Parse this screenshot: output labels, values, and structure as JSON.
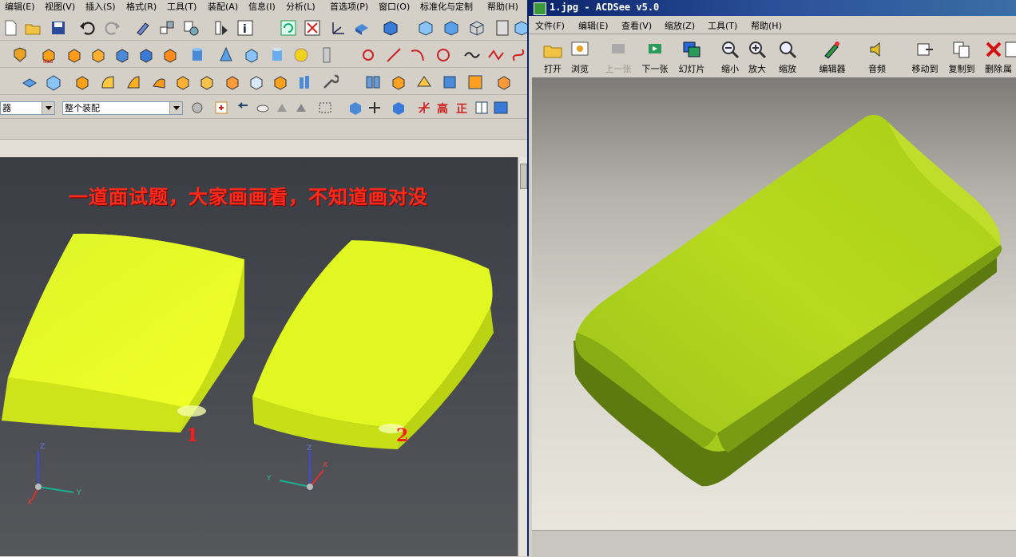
{
  "nx": {
    "menu": [
      "编辑(E)",
      "视图(V)",
      "插入(S)",
      "格式(R)",
      "工具(T)",
      "装配(A)",
      "信息(I)",
      "分析(L)",
      "首选项(P)",
      "窗口(O)",
      "标准化与定制",
      "帮助(H)"
    ],
    "filter_value": "器",
    "assembly_value": "整个装配",
    "viewport_title": "一道面试题，大家画画看，不知道画对没",
    "label_1": "1",
    "label_2": "2",
    "axes": {
      "x": "X",
      "y": "Y",
      "z": "Z"
    }
  },
  "acdsee": {
    "title": "1.jpg - ACDSee v5.0",
    "menu": [
      "文件(F)",
      "编辑(E)",
      "查看(V)",
      "缩放(Z)",
      "工具(T)",
      "帮助(H)"
    ],
    "toolbar": [
      "打开",
      "浏览",
      "上一张",
      "下一张",
      "幻灯片",
      "缩小",
      "放大",
      "缩放",
      "编辑器",
      "音频",
      "移动到",
      "复制到",
      "删除",
      "属"
    ]
  },
  "colors": {
    "model_yellow": "#d6f01a",
    "model_green": "#a6c81a",
    "title_red": "#ff2a1a",
    "titlebar_blue": "#0a246a"
  }
}
